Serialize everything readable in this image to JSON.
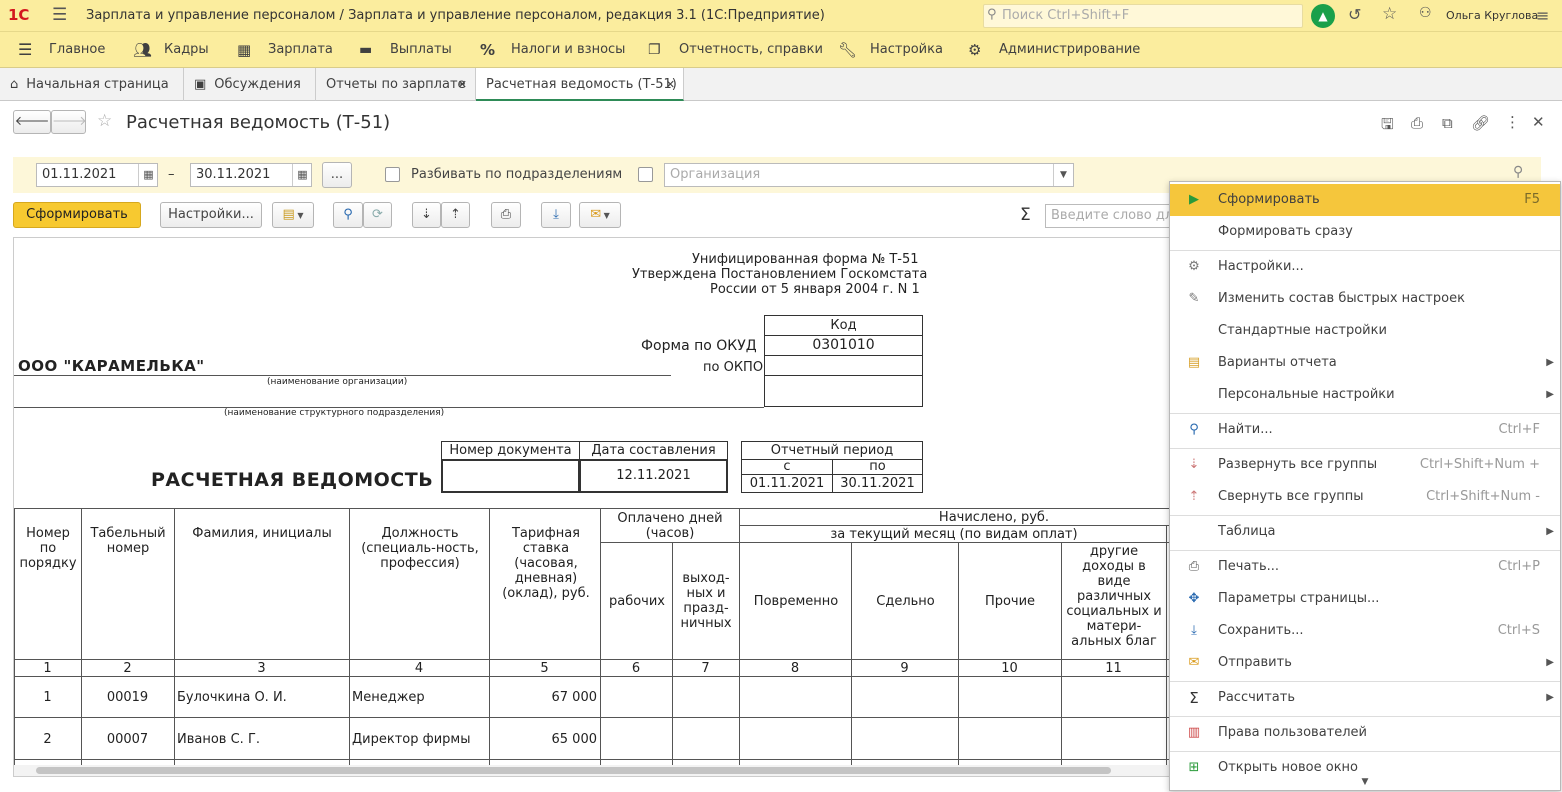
{
  "titlebar": {
    "logo": "1С",
    "title": "Зарплата и управление персоналом / Зарплата и управление персоналом, редакция 3.1  (1С:Предприятие)",
    "search_placeholder": "Поиск Ctrl+Shift+F",
    "user": "Ольга Круглова"
  },
  "menu": [
    "Главное",
    "Кадры",
    "Зарплата",
    "Выплаты",
    "Налоги и взносы",
    "Отчетность, справки",
    "Настройка",
    "Администрирование"
  ],
  "tabs": [
    "Начальная страница",
    "Обсуждения",
    "Отчеты по зарплате",
    "Расчетная ведомость (Т-51)"
  ],
  "form": {
    "title": "Расчетная ведомость (Т-51)",
    "date_from": "01.11.2021",
    "date_sep": "–",
    "date_to": "30.11.2021",
    "ellipsis": "...",
    "split_label": "Разбивать по подразделениям",
    "org_placeholder": "Организация",
    "generate_btn": "Сформировать",
    "settings_btn": "Настройки...",
    "search_placeholder": "Введите слово для"
  },
  "doc": {
    "header1": "Унифицированная форма № Т-51",
    "header2": "Утверждена Постановлением Госкомстата",
    "header3": "России от 5 января 2004 г. N 1",
    "code_label": "Код",
    "okud_label": "Форма по ОКУД",
    "okud_value": "0301010",
    "okpo_label": "по ОКПО",
    "org_name": "ООО \"КАРАМЕЛЬКА\"",
    "org_caption": "(наименование организации)",
    "dept_caption": "(наименование структурного подразделения)",
    "doc_title": "РАСЧЕТНАЯ ВЕДОМОСТЬ",
    "doc_num_label": "Номер документа",
    "doc_date_label": "Дата составления",
    "doc_date": "12.11.2021",
    "period_label": "Отчетный период",
    "period_from_label": "с",
    "period_to_label": "по",
    "period_from": "01.11.2021",
    "period_to": "30.11.2021"
  },
  "table": {
    "col_headers": {
      "num": "Номер по порядку",
      "tab": "Табельный номер",
      "fio": "Фамилия, инициалы",
      "pos": "Должность (специаль-ность, профессия)",
      "rate": "Тарифная ставка (часовая, дневная) (оклад), руб.",
      "paid": "Оплачено дней (часов)",
      "work": "рабочих",
      "holiday": "выход-ных и празд-ничных",
      "accrued": "Начислено, руб.",
      "current": "за текущий месяц (по видам оплат)",
      "time": "Повременно",
      "piece": "Сдельно",
      "other": "Прочие",
      "social": "другие доходы в виде различных социальных и матери-альных благ"
    },
    "col_numbers": [
      "1",
      "2",
      "3",
      "4",
      "5",
      "6",
      "7",
      "8",
      "9",
      "10",
      "11"
    ],
    "rows": [
      {
        "n": "1",
        "tab": "00019",
        "fio": "Булочкина О. И.",
        "pos": "Менеджер",
        "rate": "67 000"
      },
      {
        "n": "2",
        "tab": "00007",
        "fio": "Иванов С. Г.",
        "pos": "Директор фирмы",
        "rate": "65 000"
      }
    ]
  },
  "context_menu": [
    {
      "label": "Сформировать",
      "shortcut": "F5",
      "icon": "play-icon"
    },
    {
      "label": "Формировать сразу",
      "shortcut": "",
      "icon": ""
    },
    {
      "label": "Настройки...",
      "shortcut": "",
      "icon": "settings-icon"
    },
    {
      "label": "Изменить состав быстрых настроек",
      "shortcut": "",
      "icon": "pin-icon"
    },
    {
      "label": "Стандартные настройки",
      "shortcut": "",
      "icon": ""
    },
    {
      "label": "Варианты отчета",
      "shortcut": "",
      "icon": "variants-icon",
      "submenu": true
    },
    {
      "label": "Персональные настройки",
      "shortcut": "",
      "icon": "",
      "submenu": true
    },
    {
      "label": "Найти...",
      "shortcut": "Ctrl+F",
      "icon": "search-icon"
    },
    {
      "label": "Развернуть все группы",
      "shortcut": "Ctrl+Shift+Num +",
      "icon": "expand-icon"
    },
    {
      "label": "Свернуть все группы",
      "shortcut": "Ctrl+Shift+Num -",
      "icon": "collapse-icon"
    },
    {
      "label": "Таблица",
      "shortcut": "",
      "icon": "",
      "submenu": true
    },
    {
      "label": "Печать...",
      "shortcut": "Ctrl+P",
      "icon": "print-icon"
    },
    {
      "label": "Параметры страницы...",
      "shortcut": "",
      "icon": "page-params-icon"
    },
    {
      "label": "Сохранить...",
      "shortcut": "Ctrl+S",
      "icon": "save-icon"
    },
    {
      "label": "Отправить",
      "shortcut": "",
      "icon": "mail-icon",
      "submenu": true
    },
    {
      "label": "Рассчитать",
      "shortcut": "",
      "icon": "sigma-icon",
      "submenu": true
    },
    {
      "label": "Права пользователей",
      "shortcut": "",
      "icon": "rights-icon"
    },
    {
      "label": "Открыть новое окно",
      "shortcut": "",
      "icon": "new-window-icon"
    }
  ],
  "colors": {
    "accent": "#fbed9e",
    "selected": "#f5c63c",
    "green": "#2e8b57"
  }
}
